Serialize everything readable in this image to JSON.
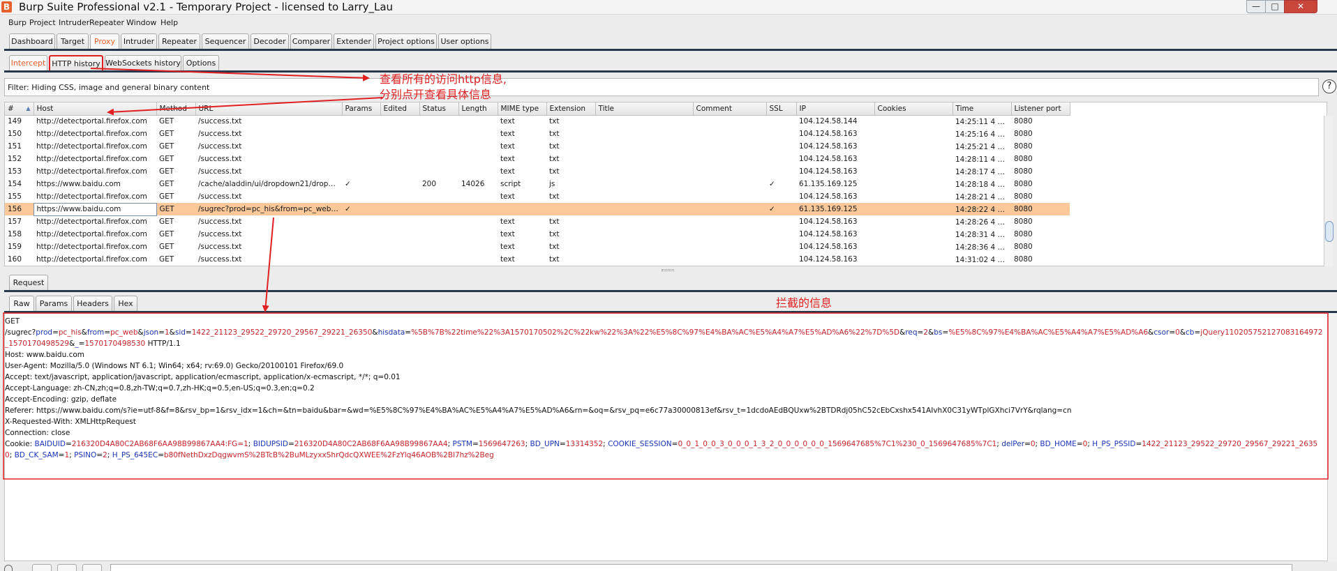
{
  "window": {
    "icon_letter": "B",
    "title": "Burp Suite Professional v2.1 - Temporary Project - licensed to Larry_Lau",
    "min_glyph": "—",
    "max_glyph": "□",
    "close_glyph": "✕"
  },
  "menubar": [
    "Burp",
    "Project",
    "Intruder",
    "Repeater",
    "Window",
    "Help"
  ],
  "main_tabs": [
    "Dashboard",
    "Target",
    "Proxy",
    "Intruder",
    "Repeater",
    "Sequencer",
    "Decoder",
    "Comparer",
    "Extender",
    "Project options",
    "User options"
  ],
  "main_tab_active": "Proxy",
  "proxy_tabs": [
    "Intercept",
    "HTTP history",
    "WebSockets history",
    "Options"
  ],
  "proxy_tab_active": "HTTP history",
  "filter_text": "Filter: Hiding CSS, image and general binary content",
  "help_glyph": "?",
  "sort_glyph": "▲",
  "columns": [
    "#",
    "Host",
    "Method",
    "URL",
    "Params",
    "Edited",
    "Status",
    "Length",
    "MIME type",
    "Extension",
    "Title",
    "Comment",
    "SSL",
    "IP",
    "Cookies",
    "Time",
    "Listener port"
  ],
  "rows": [
    {
      "num": "149",
      "host": "http://detectportal.firefox.com",
      "method": "GET",
      "url": "/success.txt",
      "params": "",
      "edited": "",
      "status": "",
      "length": "",
      "mime": "text",
      "ext": "txt",
      "title": "",
      "comment": "",
      "ssl": "",
      "ip": "104.124.58.144",
      "cookies": "",
      "time": "14:25:11 4 十...",
      "port": "8080",
      "selected": false
    },
    {
      "num": "150",
      "host": "http://detectportal.firefox.com",
      "method": "GET",
      "url": "/success.txt",
      "params": "",
      "edited": "",
      "status": "",
      "length": "",
      "mime": "text",
      "ext": "txt",
      "title": "",
      "comment": "",
      "ssl": "",
      "ip": "104.124.58.163",
      "cookies": "",
      "time": "14:25:16 4 十...",
      "port": "8080",
      "selected": false
    },
    {
      "num": "151",
      "host": "http://detectportal.firefox.com",
      "method": "GET",
      "url": "/success.txt",
      "params": "",
      "edited": "",
      "status": "",
      "length": "",
      "mime": "text",
      "ext": "txt",
      "title": "",
      "comment": "",
      "ssl": "",
      "ip": "104.124.58.163",
      "cookies": "",
      "time": "14:25:21 4 十...",
      "port": "8080",
      "selected": false
    },
    {
      "num": "152",
      "host": "http://detectportal.firefox.com",
      "method": "GET",
      "url": "/success.txt",
      "params": "",
      "edited": "",
      "status": "",
      "length": "",
      "mime": "text",
      "ext": "txt",
      "title": "",
      "comment": "",
      "ssl": "",
      "ip": "104.124.58.163",
      "cookies": "",
      "time": "14:28:11 4 十...",
      "port": "8080",
      "selected": false
    },
    {
      "num": "153",
      "host": "http://detectportal.firefox.com",
      "method": "GET",
      "url": "/success.txt",
      "params": "",
      "edited": "",
      "status": "",
      "length": "",
      "mime": "text",
      "ext": "txt",
      "title": "",
      "comment": "",
      "ssl": "",
      "ip": "104.124.58.163",
      "cookies": "",
      "time": "14:28:17 4 十...",
      "port": "8080",
      "selected": false
    },
    {
      "num": "154",
      "host": "https://www.baidu.com",
      "method": "GET",
      "url": "/cache/aladdin/ui/dropdown21/dropdo...",
      "params": "✓",
      "edited": "",
      "status": "200",
      "length": "14026",
      "mime": "script",
      "ext": "js",
      "title": "",
      "comment": "",
      "ssl": "✓",
      "ip": "61.135.169.125",
      "cookies": "",
      "time": "14:28:18 4 十...",
      "port": "8080",
      "selected": false
    },
    {
      "num": "155",
      "host": "http://detectportal.firefox.com",
      "method": "GET",
      "url": "/success.txt",
      "params": "",
      "edited": "",
      "status": "",
      "length": "",
      "mime": "text",
      "ext": "txt",
      "title": "",
      "comment": "",
      "ssl": "",
      "ip": "104.124.58.163",
      "cookies": "",
      "time": "14:28:21 4 十...",
      "port": "8080",
      "selected": false
    },
    {
      "num": "156",
      "host": "https://www.baidu.com",
      "method": "GET",
      "url": "/sugrec?prod=pc_his&from=pc_web&j...",
      "params": "✓",
      "edited": "",
      "status": "",
      "length": "",
      "mime": "",
      "ext": "",
      "title": "",
      "comment": "",
      "ssl": "✓",
      "ip": "61.135.169.125",
      "cookies": "",
      "time": "14:28:22 4 十...",
      "port": "8080",
      "selected": true
    },
    {
      "num": "157",
      "host": "http://detectportal.firefox.com",
      "method": "GET",
      "url": "/success.txt",
      "params": "",
      "edited": "",
      "status": "",
      "length": "",
      "mime": "text",
      "ext": "txt",
      "title": "",
      "comment": "",
      "ssl": "",
      "ip": "104.124.58.163",
      "cookies": "",
      "time": "14:28:26 4 十...",
      "port": "8080",
      "selected": false
    },
    {
      "num": "158",
      "host": "http://detectportal.firefox.com",
      "method": "GET",
      "url": "/success.txt",
      "params": "",
      "edited": "",
      "status": "",
      "length": "",
      "mime": "text",
      "ext": "txt",
      "title": "",
      "comment": "",
      "ssl": "",
      "ip": "104.124.58.163",
      "cookies": "",
      "time": "14:28:31 4 十...",
      "port": "8080",
      "selected": false
    },
    {
      "num": "159",
      "host": "http://detectportal.firefox.com",
      "method": "GET",
      "url": "/success.txt",
      "params": "",
      "edited": "",
      "status": "",
      "length": "",
      "mime": "text",
      "ext": "txt",
      "title": "",
      "comment": "",
      "ssl": "",
      "ip": "104.124.58.163",
      "cookies": "",
      "time": "14:28:36 4 十...",
      "port": "8080",
      "selected": false
    },
    {
      "num": "160",
      "host": "http://detectportal.firefox.com",
      "method": "GET",
      "url": "/success.txt",
      "params": "",
      "edited": "",
      "status": "",
      "length": "",
      "mime": "text",
      "ext": "txt",
      "title": "",
      "comment": "",
      "ssl": "",
      "ip": "104.124.58.163",
      "cookies": "",
      "time": "14:31:02 4 十...",
      "port": "8080",
      "selected": false
    }
  ],
  "request_tab": "Request",
  "message_tabs": [
    "Raw",
    "Params",
    "Headers",
    "Hex"
  ],
  "message_tab_active": "Raw",
  "request_lines": [
    [
      {
        "t": "GET "
      }
    ],
    [
      {
        "t": "/sugrec?"
      },
      {
        "t": "prod",
        "c": "pname"
      },
      {
        "t": "="
      },
      {
        "t": "pc_his",
        "c": "pval"
      },
      {
        "t": "&"
      },
      {
        "t": "from",
        "c": "pname"
      },
      {
        "t": "="
      },
      {
        "t": "pc_web",
        "c": "pval"
      },
      {
        "t": "&"
      },
      {
        "t": "json",
        "c": "pname"
      },
      {
        "t": "="
      },
      {
        "t": "1",
        "c": "pval"
      },
      {
        "t": "&"
      },
      {
        "t": "sid",
        "c": "pname"
      },
      {
        "t": "="
      },
      {
        "t": "1422_21123_29522_29720_29567_29221_26350",
        "c": "pval"
      },
      {
        "t": "&"
      },
      {
        "t": "hisdata",
        "c": "pname"
      },
      {
        "t": "="
      },
      {
        "t": "%5B%7B%22time%22%3A1570170502%2C%22kw%22%3A%22%E5%8C%97%E4%BA%AC%E5%A4%A7%E5%AD%A6%22%7D%5D",
        "c": "pval"
      },
      {
        "t": "&"
      },
      {
        "t": "req",
        "c": "pname"
      },
      {
        "t": "="
      },
      {
        "t": "2",
        "c": "pval"
      },
      {
        "t": "&"
      },
      {
        "t": "bs",
        "c": "pname"
      },
      {
        "t": "="
      },
      {
        "t": "%E5%8C%97%E4%BA%AC%E5%A4%A7%E5%AD%A6",
        "c": "pval"
      },
      {
        "t": "&"
      },
      {
        "t": "csor",
        "c": "pname"
      },
      {
        "t": "="
      },
      {
        "t": "0",
        "c": "pval"
      },
      {
        "t": "&"
      },
      {
        "t": "cb",
        "c": "pname"
      },
      {
        "t": "="
      },
      {
        "t": "jQuery110205752127083164972_1570170498529",
        "c": "pval"
      },
      {
        "t": "&"
      },
      {
        "t": "_",
        "c": "pname"
      },
      {
        "t": "="
      },
      {
        "t": "1570170498530",
        "c": "pval"
      },
      {
        "t": " HTTP/1.1"
      }
    ],
    [
      {
        "t": "Host: www.baidu.com"
      }
    ],
    [
      {
        "t": "User-Agent: Mozilla/5.0 (Windows NT 6.1; Win64; x64; rv:69.0) Gecko/20100101 Firefox/69.0"
      }
    ],
    [
      {
        "t": "Accept: text/javascript, application/javascript, application/ecmascript, application/x-ecmascript, */*; q=0.01"
      }
    ],
    [
      {
        "t": "Accept-Language: zh-CN,zh;q=0.8,zh-TW;q=0.7,zh-HK;q=0.5,en-US;q=0.3,en;q=0.2"
      }
    ],
    [
      {
        "t": "Accept-Encoding: gzip, deflate"
      }
    ],
    [
      {
        "t": "Referer: https://www.baidu.com/s?ie=utf-8&f=8&rsv_bp=1&rsv_idx=1&ch=&tn=baidu&bar=&wd=%E5%8C%97%E4%BA%AC%E5%A4%A7%E5%AD%A6&rn=&oq=&rsv_pq=e6c77a30000813ef&rsv_t=1dcdoAEdBQUxw%2BTDRdj05hC52cEbCxshx541AIvhX0C31yWTplGXhci7VrY&rqlang=cn"
      }
    ],
    [
      {
        "t": "X-Requested-With: XMLHttpRequest"
      }
    ],
    [
      {
        "t": "Connection: close"
      }
    ],
    [
      {
        "t": "Cookie: "
      },
      {
        "t": "BAIDUID",
        "c": "pname"
      },
      {
        "t": "="
      },
      {
        "t": "216320D4A80C2AB68F6AA98B99867AA4:FG=1",
        "c": "pval"
      },
      {
        "t": "; "
      },
      {
        "t": "BIDUPSID",
        "c": "pname"
      },
      {
        "t": "="
      },
      {
        "t": "216320D4A80C2AB68F6AA98B99867AA4",
        "c": "pval"
      },
      {
        "t": "; "
      },
      {
        "t": "PSTM",
        "c": "pname"
      },
      {
        "t": "="
      },
      {
        "t": "1569647263",
        "c": "pval"
      },
      {
        "t": "; "
      },
      {
        "t": "BD_UPN",
        "c": "pname"
      },
      {
        "t": "="
      },
      {
        "t": "13314352",
        "c": "pval"
      },
      {
        "t": "; "
      },
      {
        "t": "COOKIE_SESSION",
        "c": "pname"
      },
      {
        "t": "="
      },
      {
        "t": "0_0_1_0_0_3_0_0_0_1_3_2_0_0_0_0_0_0_1569647685%7C1%230_0_1569647685%7C1",
        "c": "pval"
      },
      {
        "t": "; "
      },
      {
        "t": "delPer",
        "c": "pname"
      },
      {
        "t": "="
      },
      {
        "t": "0",
        "c": "pval"
      },
      {
        "t": "; "
      },
      {
        "t": "BD_HOME",
        "c": "pname"
      },
      {
        "t": "="
      },
      {
        "t": "0",
        "c": "pval"
      },
      {
        "t": "; "
      },
      {
        "t": "H_PS_PSSID",
        "c": "pname"
      },
      {
        "t": "="
      },
      {
        "t": "1422_21123_29522_29720_29567_29221_26350",
        "c": "pval"
      },
      {
        "t": "; "
      },
      {
        "t": "BD_CK_SAM",
        "c": "pname"
      },
      {
        "t": "="
      },
      {
        "t": "1",
        "c": "pval"
      },
      {
        "t": "; "
      },
      {
        "t": "PSINO",
        "c": "pname"
      },
      {
        "t": "="
      },
      {
        "t": "2",
        "c": "pval"
      },
      {
        "t": "; "
      },
      {
        "t": "H_PS_645EC",
        "c": "pname"
      },
      {
        "t": "="
      },
      {
        "t": "b80fNethDxzDqgwvmS%2BTcB%2BuMLzyxxShrQdcQXWEE%2FzYlq46AOB%2Bl7hz%2Beg",
        "c": "pval"
      }
    ]
  ],
  "annotations": {
    "history_note_1": "查看所有的访问http信息,",
    "history_note_2": "分别点开查看具体信息",
    "intercept_note": "拦截的信息"
  },
  "colors": {
    "accent": "#e8612c",
    "selected_row": "#fbc89a",
    "tab_bar": "#27374e",
    "annotation": "#e02020",
    "param_name": "#1a35b8",
    "param_value": "#c8262d"
  }
}
